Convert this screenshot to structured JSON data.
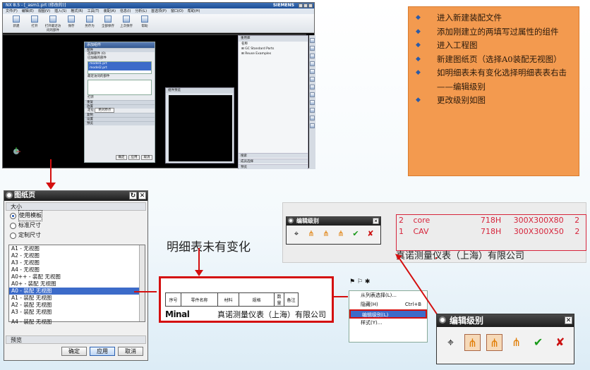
{
  "nx_window": {
    "title": "NX 8.5 - [_asm1.prt (修改的)]",
    "brand": "SIEMENS",
    "menus": [
      "文件(F)",
      "编辑(E)",
      "视图(V)",
      "插入(S)",
      "格式(R)",
      "工具(T)",
      "装配(A)",
      "信息(I)",
      "分析(L)",
      "首选项(P)",
      "窗口(O)",
      "帮助(H)"
    ],
    "toolbar": [
      "新建",
      "打开",
      "打开最近访问的部件",
      "保存",
      "另存为",
      "全部保存",
      "上次保存",
      "帮助"
    ],
    "add_component": {
      "title": "添加组件",
      "sections": [
        "部件",
        "已加载的部件",
        "最近访问的部件",
        "打开",
        "重复",
        "放置",
        "定位",
        "复制",
        "设置",
        "预览"
      ],
      "select_label": "选择部件 (0)",
      "loaded": [
        "model1.prt",
        "model2.prt"
      ],
      "position_value": "绝对原点",
      "buttons": [
        "确定",
        "应用",
        "取消"
      ]
    },
    "preview": {
      "title": "组件预览"
    },
    "resource": {
      "title": "重用库",
      "name_col": "名称",
      "items": [
        "GC Standard Parts",
        "Reuse Examples"
      ],
      "footer": [
        "搜索",
        "成员选择",
        "预览"
      ]
    }
  },
  "notes": [
    "进入新建装配文件",
    "添加刚建立的两填写过属性的组件",
    "进入工程图",
    "新建图纸页（选择A0装配无视图）",
    "如明细表未有变化选择明细表表右击——编辑级别",
    "更改级别如图"
  ],
  "sheet_dialog": {
    "title": "图纸页",
    "size_group": "大小",
    "options": [
      "使用模板",
      "标准尺寸",
      "定制尺寸"
    ],
    "list": [
      "A1 - 无视图",
      "A2 - 无视图",
      "A3 - 无视图",
      "A4 - 无视图",
      "A0++ - 装配 无视图",
      "A0+ - 装配 无视图",
      "A0 - 装配 无视图",
      "A1 - 装配 无视图",
      "A2 - 装配 无视图",
      "A3 - 装配 无视图",
      "A4 - 装配 无视图"
    ],
    "selected_index": 6,
    "preview_group": "预览",
    "buttons": [
      "确定",
      "应用",
      "取消"
    ]
  },
  "annotation": "明细表未有变化",
  "parts_list": {
    "headers": [
      "序号",
      "零件名称",
      "材料",
      "规格",
      "数量",
      "备注"
    ],
    "logo": "Minal",
    "company": "真诺测量仪表（上海）有限公司"
  },
  "level_table": {
    "rows": [
      {
        "no": "2",
        "name": "core",
        "material": "718H",
        "size": "300X300X80",
        "qty": "2"
      },
      {
        "no": "1",
        "name": "CAV",
        "material": "718H",
        "size": "300X300X50",
        "qty": "2"
      }
    ],
    "company": "真诺测量仪表（上海）有限公司"
  },
  "edit_level": {
    "title": "编辑级别"
  },
  "context_menu": {
    "items": [
      {
        "label": "从列表选择(L)...",
        "key": ""
      },
      {
        "label": "隐藏(H)",
        "key": "Ctrl+B"
      },
      {
        "label": "编辑级别(L)",
        "key": ""
      },
      {
        "label": "样式(Y)...",
        "key": ""
      }
    ]
  },
  "colors": {
    "accent_red": "#d40f0f",
    "notes_bg": "#f39a4f",
    "selection": "#3c6bc9"
  }
}
